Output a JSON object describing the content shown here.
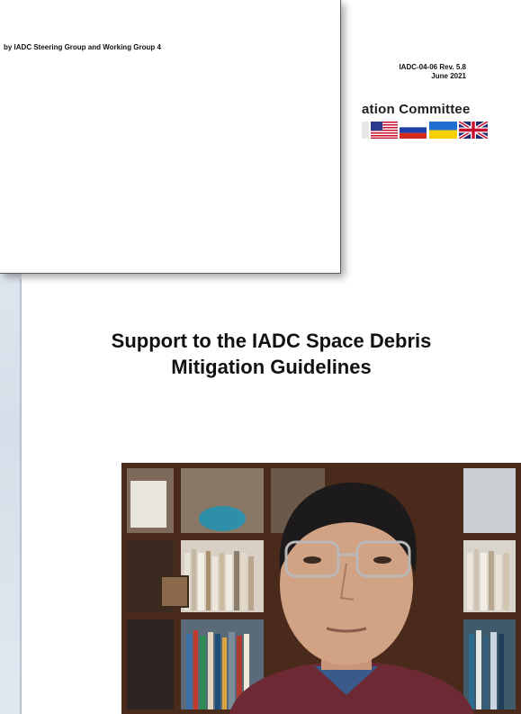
{
  "front_page": {
    "text": "by IADC Steering Group and Working Group 4"
  },
  "document": {
    "ref_number": "IADC-04-06 Rev. 5.8",
    "ref_date": "June 2021",
    "committee_text": "ation Committee",
    "title_line1": "Support to the IADC Space Debris",
    "title_line2": "Mitigation Guidelines",
    "flags": [
      "usa-flag",
      "russia-flag",
      "ukraine-flag",
      "uk-flag"
    ]
  },
  "webcam": {
    "description_icon": "participant-video-feed"
  },
  "colors": {
    "title_text": "#111111",
    "page_border": "#5f5f5f",
    "shelf_wood": "#6b3a22"
  }
}
